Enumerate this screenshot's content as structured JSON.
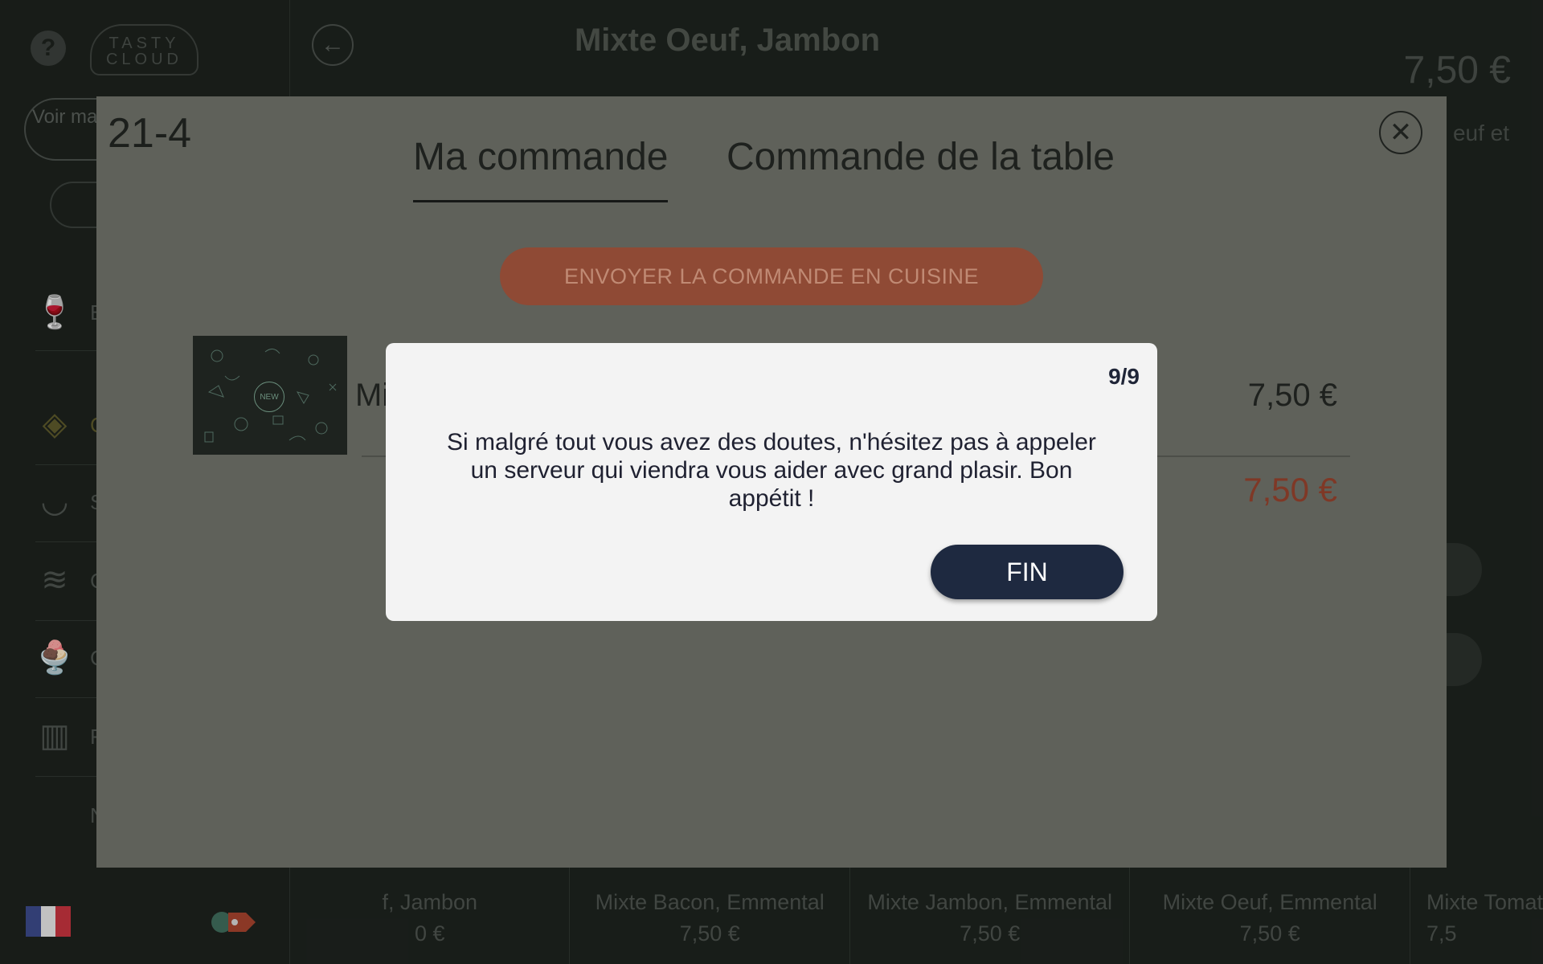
{
  "background": {
    "brand": "TASTY CLOUD",
    "voir_button": "Voir ma",
    "categories": [
      "B",
      "C",
      "S",
      "C",
      "C",
      "F",
      "N"
    ],
    "product_title": "Mixte Oeuf, Jambon",
    "product_price": "7,50 €",
    "description_snippet": "euf et",
    "bottom_cards": [
      {
        "name": "f, Jambon",
        "price": "0 €"
      },
      {
        "name": "Mixte Bacon, Emmental",
        "price": "7,50 €"
      },
      {
        "name": "Mixte Jambon, Emmental",
        "price": "7,50 €"
      },
      {
        "name": "Mixte Oeuf, Emmental",
        "price": "7,50 €"
      },
      {
        "name": "Mixte Tomat",
        "price": "7,5"
      }
    ],
    "flag_colors": [
      "#3b4a8c",
      "#e9e9e9",
      "#c9323d"
    ]
  },
  "order_modal": {
    "table_id": "21-4",
    "tabs": [
      {
        "label": "Ma commande",
        "active": true
      },
      {
        "label": "Commande de la table",
        "active": false
      }
    ],
    "send_button": "ENVOYER LA COMMANDE EN CUISINE",
    "item": {
      "name": "Mi",
      "price": "7,50 €",
      "thumb_badge": "NEW"
    },
    "total": "7,50 €"
  },
  "tutorial": {
    "step": "9/9",
    "message": "Si malgré tout vous avez des doutes, n'hésitez pas à appeler un serveur qui viendra vous aider avec grand plasir. Bon appétit !",
    "fin_button": "FIN"
  },
  "colors": {
    "accent_button": "#1e2940",
    "send_button": "#8f4a35",
    "total_price": "#7f3826"
  }
}
